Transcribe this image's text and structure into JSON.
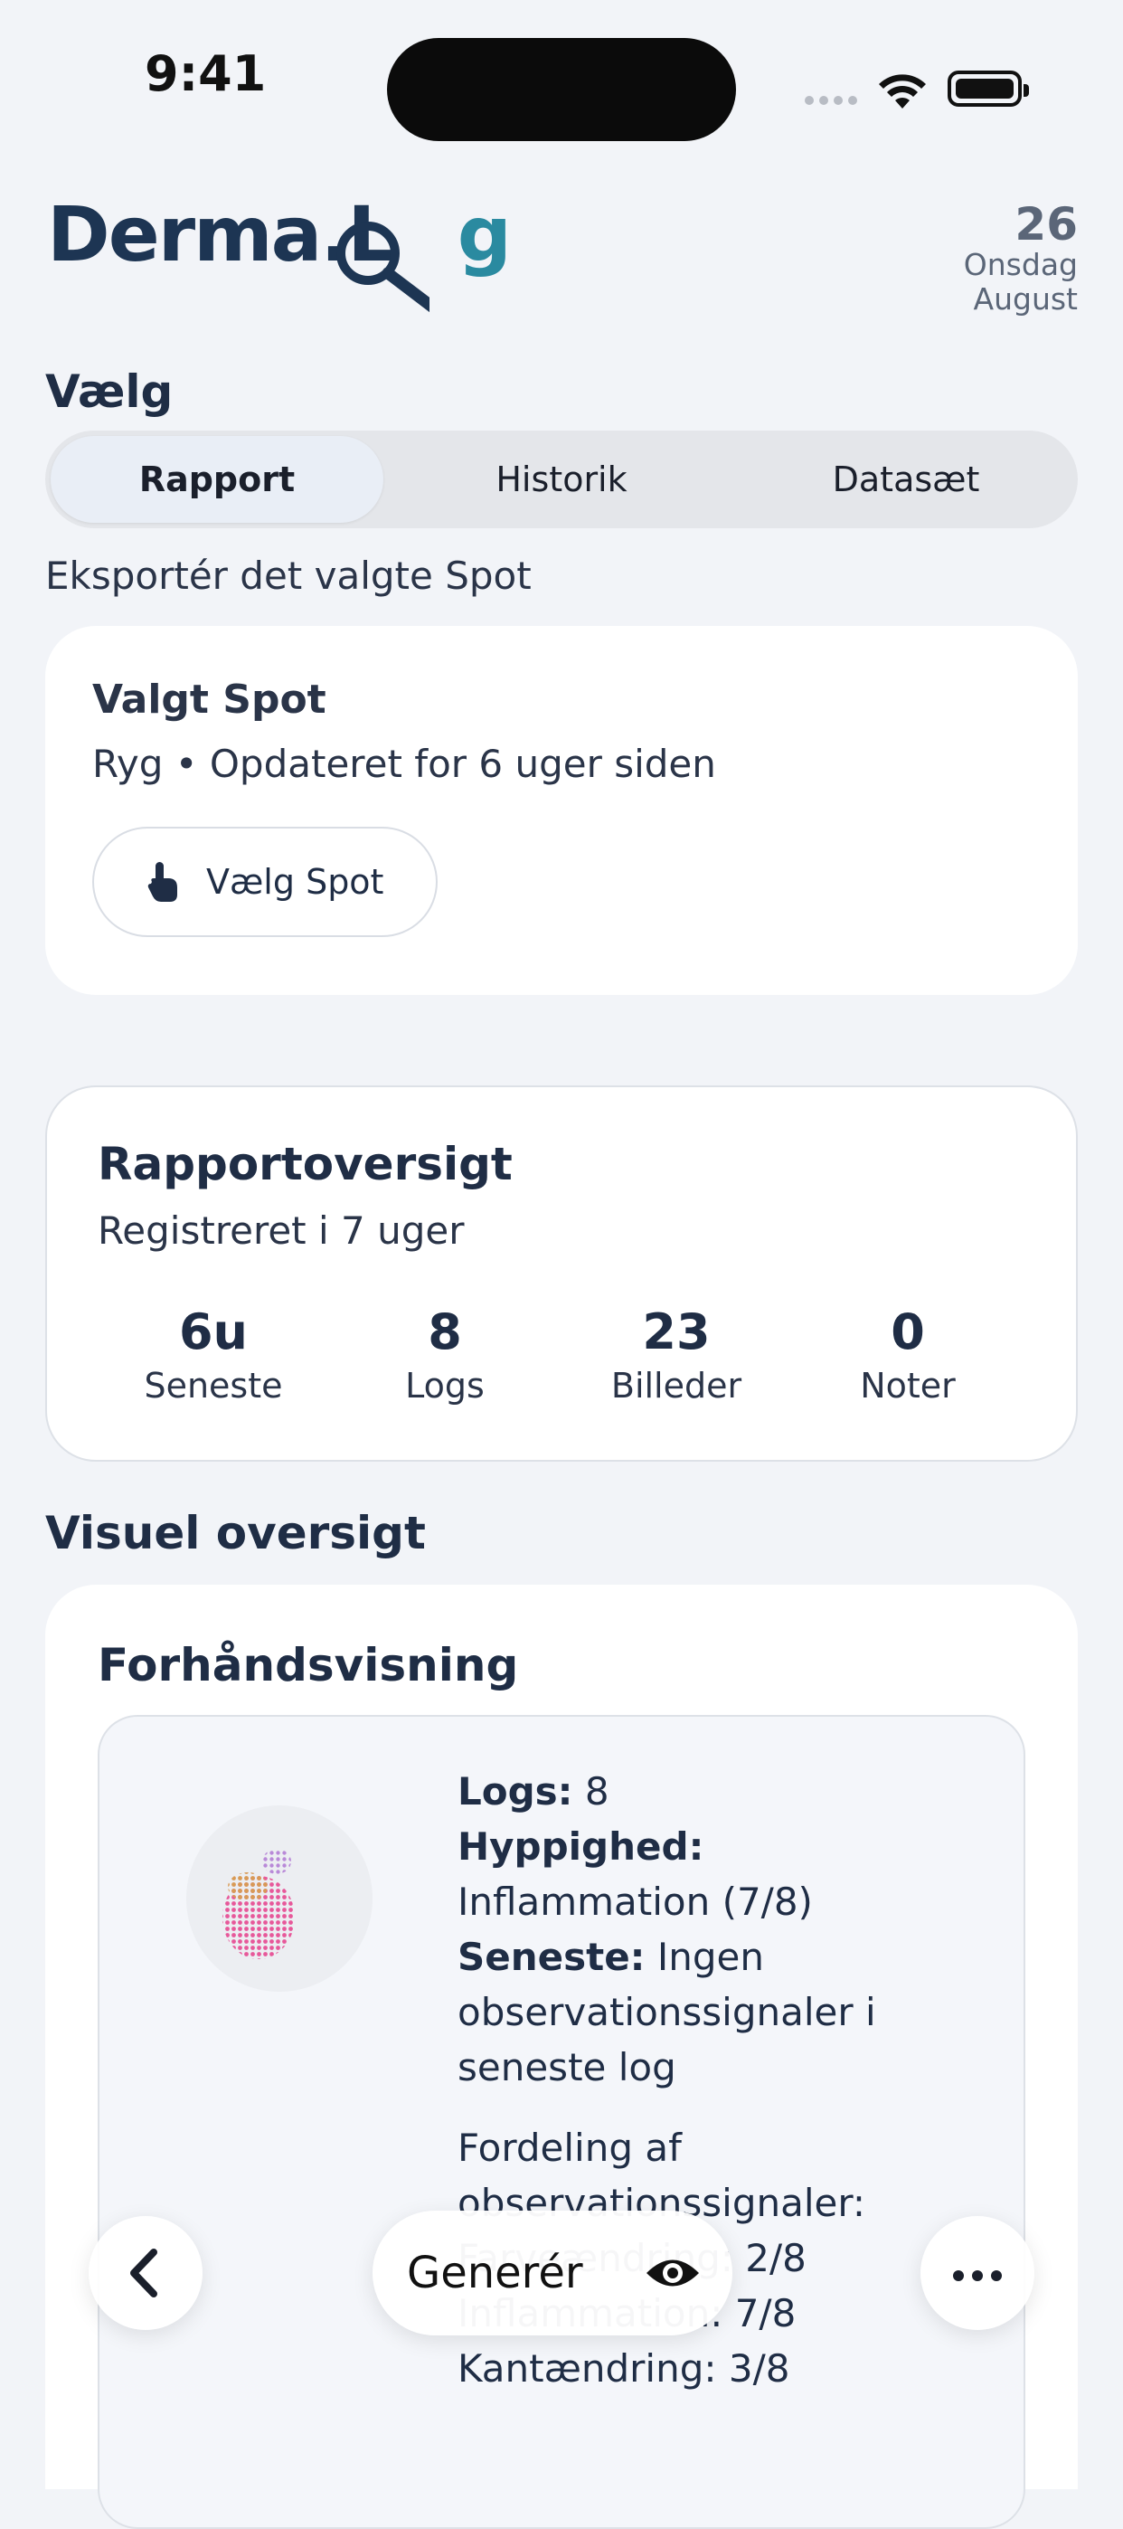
{
  "status_bar": {
    "time": "9:41"
  },
  "header": {
    "logo_part1": "Derma.L",
    "logo_part2": "g",
    "date_day": "26",
    "date_weekday": "Onsdag",
    "date_month": "August"
  },
  "select": {
    "heading": "Vælg",
    "tabs": [
      {
        "label": "Rapport",
        "active": true
      },
      {
        "label": "Historik",
        "active": false
      },
      {
        "label": "Datasæt",
        "active": false
      }
    ]
  },
  "export_label": "Eksportér det valgte Spot",
  "spot_card": {
    "title": "Valgt Spot",
    "subtitle": "Ryg • Opdateret for 6 uger siden",
    "button_label": "Vælg Spot"
  },
  "overview": {
    "title": "Rapportoversigt",
    "subtitle": "Registreret i 7 uger",
    "stats": [
      {
        "value": "6u",
        "label": "Seneste"
      },
      {
        "value": "8",
        "label": "Logs"
      },
      {
        "value": "23",
        "label": "Billeder"
      },
      {
        "value": "0",
        "label": "Noter"
      }
    ]
  },
  "visual": {
    "heading": "Visuel oversigt",
    "preview_title": "Forhåndsvisning",
    "logs_label": "Logs:",
    "logs_value": " 8",
    "freq_label": "Hyppighed:",
    "freq_value": " Inflammation (7/8)",
    "latest_label": "Seneste:",
    "latest_value": " Ingen observationssignaler i seneste log",
    "dist_label": "Fordeling af observationssignaler:",
    "dist_items": [
      "Farveændring: 2/8",
      "Inflammation: 7/8",
      "Kantændring: 3/8"
    ]
  },
  "toolbar": {
    "back_icon": "chevron-left-icon",
    "generate_label": "Generér",
    "eye_icon": "eye-icon",
    "more_icon": "ellipsis-icon"
  },
  "colors": {
    "background": "#f2f4f8",
    "logo_dark": "#1d3553",
    "logo_accent": "#2a8aa0",
    "text": "#1f2d45"
  }
}
